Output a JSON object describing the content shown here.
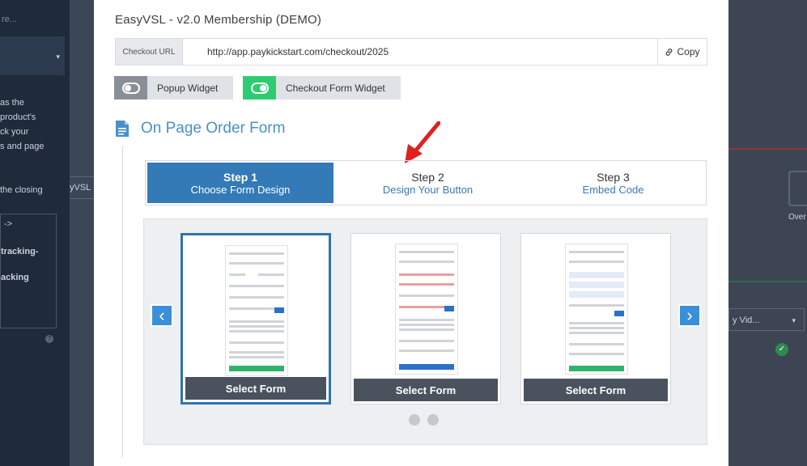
{
  "background": {
    "left_texts": [
      "re...",
      "as the",
      "product's",
      "ck your",
      "s and page",
      "the closing",
      "->",
      "tracking-",
      "acking"
    ],
    "strip_text": "yVSL",
    "right_texts": [
      "Over",
      "y Vid..."
    ]
  },
  "modal": {
    "title": "EasyVSL - v2.0 Membership (DEMO)",
    "checkout": {
      "label": "Checkout URL",
      "url": "http://app.paykickstart.com/checkout/2025",
      "copy_label": "Copy"
    },
    "toggles": [
      {
        "label": "Popup Widget",
        "state": "off",
        "color": "#8a8f96"
      },
      {
        "label": "Checkout Form Widget",
        "state": "on",
        "color": "#2ecc71"
      }
    ],
    "section_title": "On Page Order Form",
    "steps": [
      {
        "number": "Step 1",
        "desc": "Choose Form Design",
        "active": true
      },
      {
        "number": "Step 2",
        "desc": "Design Your Button",
        "active": false
      },
      {
        "number": "Step 3",
        "desc": "Embed Code",
        "active": false
      }
    ],
    "carousel": {
      "cards": [
        {
          "button": "Select Form",
          "selected": true
        },
        {
          "button": "Select Form",
          "selected": false
        },
        {
          "button": "Select Form",
          "selected": false
        }
      ],
      "prev_icon": "chevron-left-icon",
      "next_icon": "chevron-right-icon",
      "dots": 2
    }
  },
  "colors": {
    "accent": "#337ab7",
    "heading": "#4a90c8",
    "arrow": "#e02020"
  }
}
